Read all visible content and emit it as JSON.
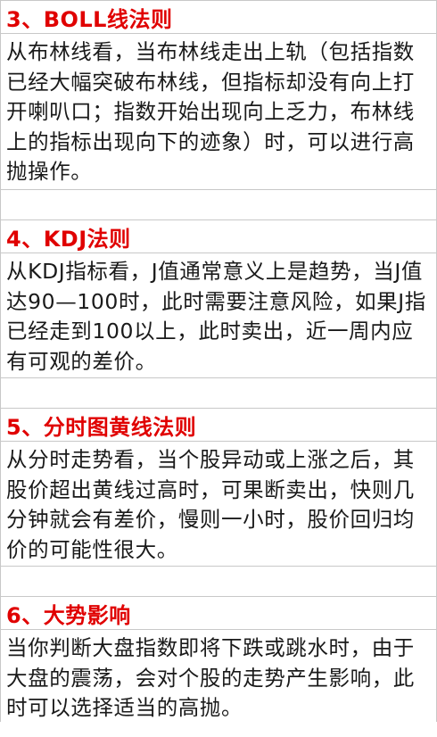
{
  "sections": [
    {
      "heading": "3、BOLL线法则",
      "body": "从布林线看，当布林线走出上轨（包括指数已经大幅突破布林线，但指标却没有向上打开喇叭口；指数开始出现向上乏力，布林线上的指标出现向下的迹象）时，可以进行高抛操作。"
    },
    {
      "heading": "4、KDJ法则",
      "body": "从KDJ指标看，J值通常意义上是趋势，当J值达90—100时，此时需要注意风险，如果J指已经走到100以上，此时卖出，近一周内应有可观的差价。"
    },
    {
      "heading": "5、分时图黄线法则",
      "body": "从分时走势看，当个股异动或上涨之后，其股价超出黄线过高时，可果断卖出，快则几分钟就会有差价，慢则一小时，股价回归均价的可能性很大。"
    },
    {
      "heading": "6、大势影响",
      "body": "当你判断大盘指数即将下跌或跳水时，由于大盘的震荡，会对个股的走势产生影响，此时可以选择适当的高抛。"
    }
  ],
  "colors": {
    "heading": "#e00000",
    "body_text": "#1a1a1a",
    "grid_line": "#c8c8c8"
  }
}
